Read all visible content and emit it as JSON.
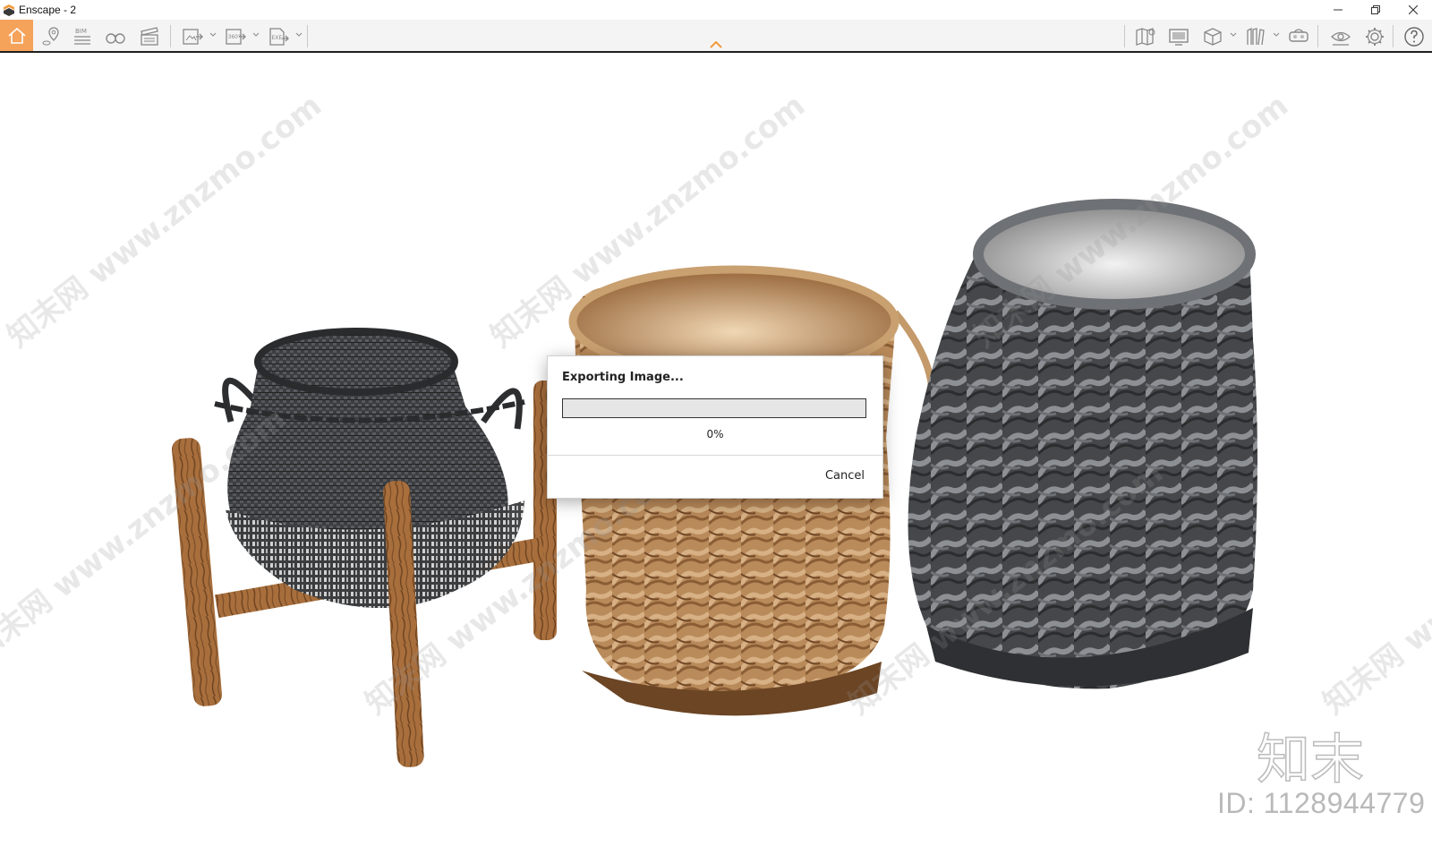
{
  "window": {
    "title": "Enscape - 2",
    "controls": [
      "minimize",
      "restore",
      "close"
    ]
  },
  "toolbar": {
    "left_buttons": [
      {
        "id": "home",
        "icon": "home-icon",
        "active": true
      },
      {
        "id": "views",
        "icon": "location-pin-icon"
      },
      {
        "id": "bim",
        "icon": "bim-icon",
        "label": "BIM"
      },
      {
        "id": "walk",
        "icon": "binoculars-icon"
      },
      {
        "id": "video",
        "icon": "clapperboard-icon"
      },
      {
        "id": "export-image",
        "icon": "image-export-icon",
        "dropdown": true
      },
      {
        "id": "export-panorama",
        "icon": "panorama-export-icon",
        "label": "360°",
        "dropdown": true
      },
      {
        "id": "export-exe",
        "icon": "exe-export-icon",
        "label": "EXE",
        "dropdown": true
      }
    ],
    "right_buttons": [
      {
        "id": "map",
        "icon": "map-icon"
      },
      {
        "id": "screen",
        "icon": "monitor-icon"
      },
      {
        "id": "asset",
        "icon": "cube-icon",
        "dropdown": true
      },
      {
        "id": "library",
        "icon": "books-icon",
        "dropdown": true
      },
      {
        "id": "vr",
        "icon": "vr-headset-icon"
      },
      {
        "id": "visual",
        "icon": "eye-icon"
      },
      {
        "id": "settings",
        "icon": "gear-icon"
      },
      {
        "id": "help",
        "icon": "help-icon"
      }
    ],
    "accent_color": "#f5a25a"
  },
  "dialog": {
    "title": "Exporting Image...",
    "progress_percent": 0,
    "progress_label": "0%",
    "cancel_label": "Cancel"
  },
  "watermarks": {
    "text": "知末网 www.znzmo.com",
    "brand": "知末",
    "id_label": "ID: 1128944779"
  }
}
